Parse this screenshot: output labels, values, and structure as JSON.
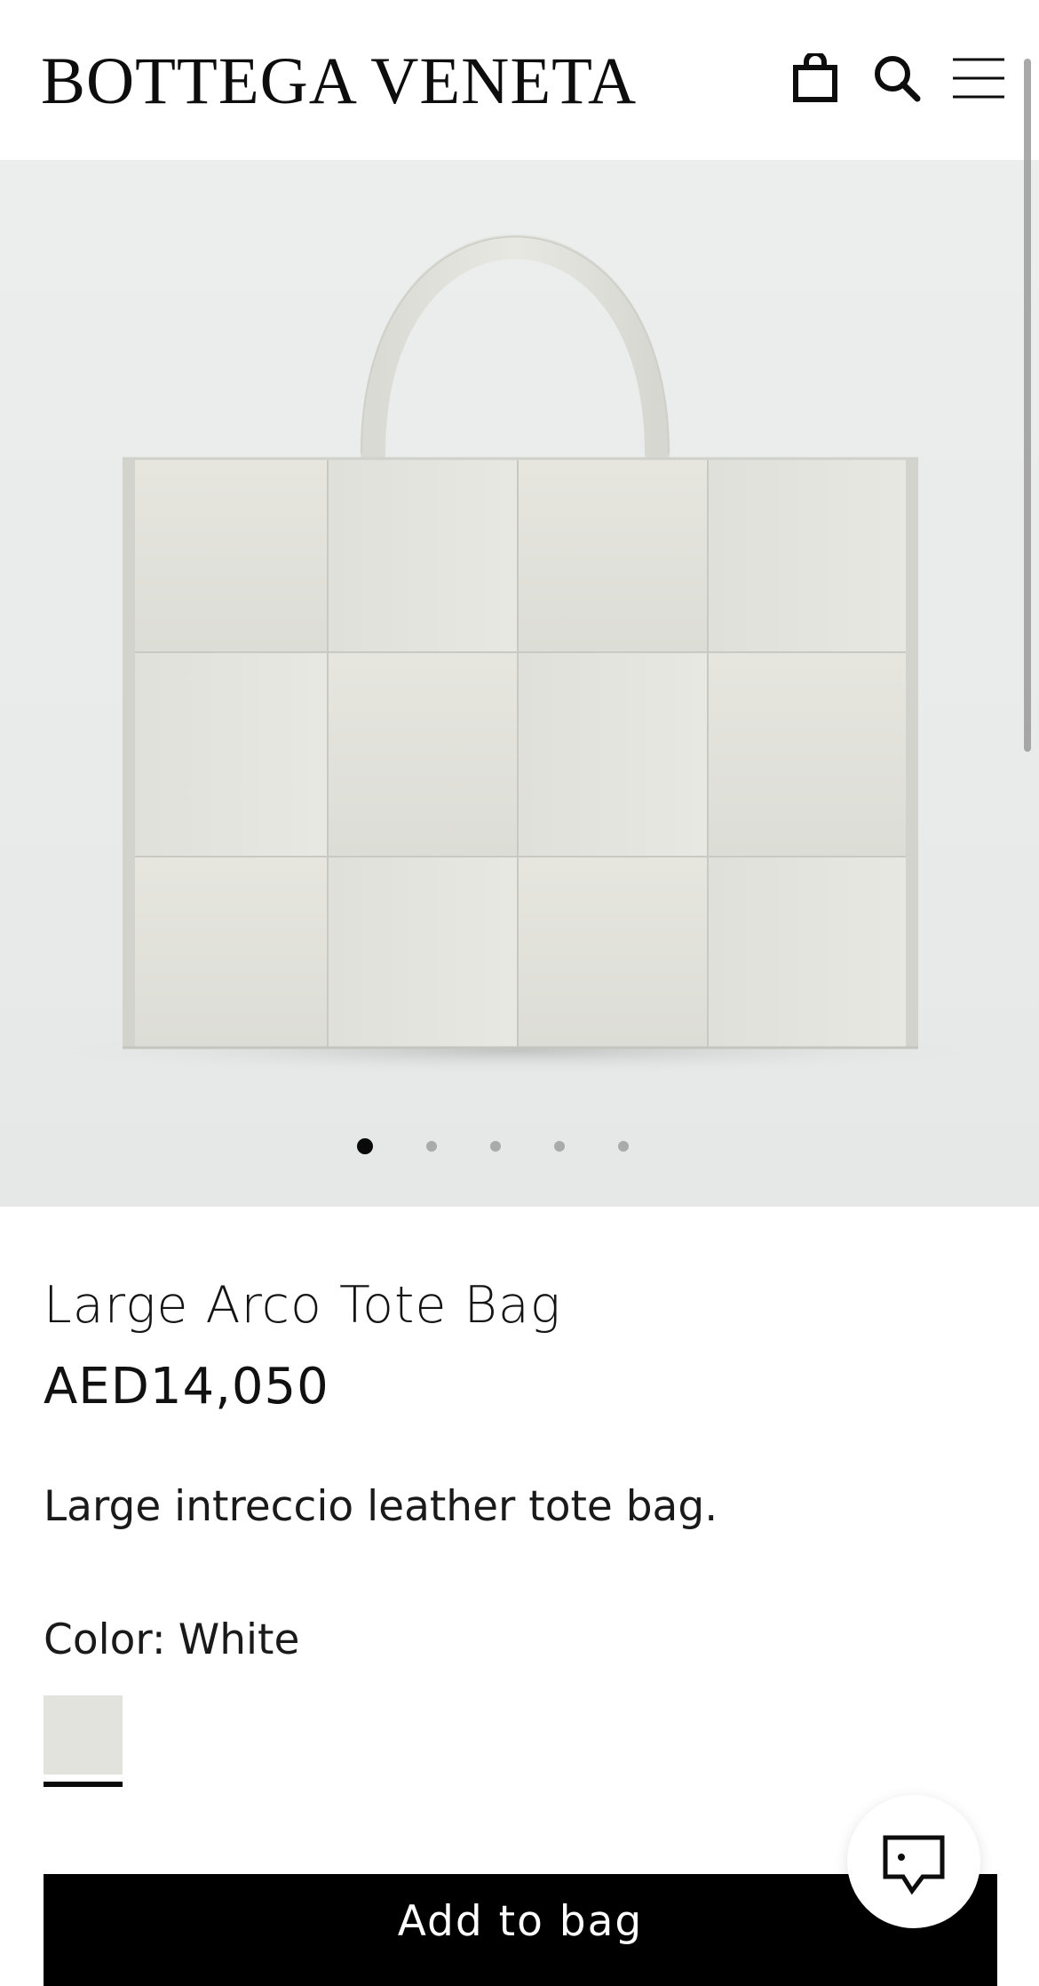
{
  "header": {
    "logo_text": "BOTTEGA VENETA",
    "icons": [
      "shopping-bag-icon",
      "search-icon",
      "hamburger-menu-icon"
    ]
  },
  "gallery": {
    "slide_count": 5,
    "active_index": 0,
    "colors": {
      "background": "#eceeee",
      "bag": "#e3e3dc",
      "active_dot": "#0a0a0a",
      "inactive_dot": "#a9abab"
    }
  },
  "product": {
    "name": "Large Arco Tote Bag",
    "price": "AED14,050",
    "description": "Large intreccio leather tote bag.",
    "color_label": "Color:",
    "color_value": "White",
    "swatch_color": "#e2e3dc"
  },
  "actions": {
    "add_to_bag_label": "Add to bag",
    "chat_icon": "chat-bubble-icon"
  }
}
